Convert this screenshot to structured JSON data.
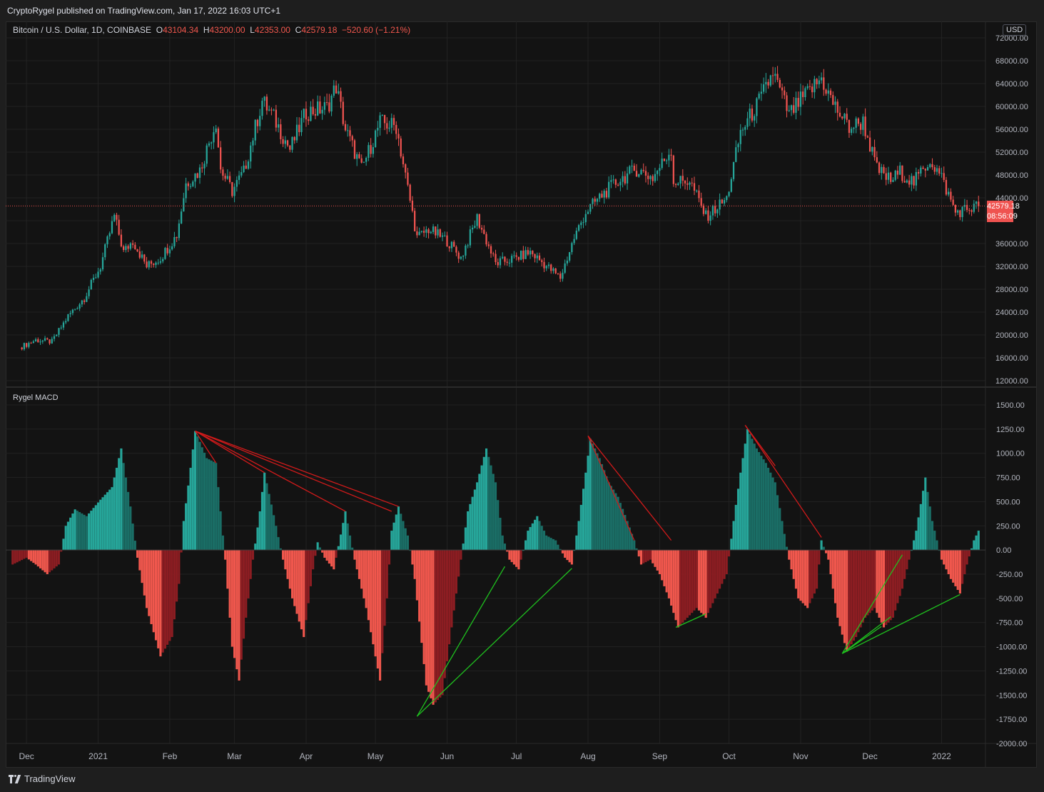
{
  "header": {
    "published": "CryptoRygel published on TradingView.com, Jan 17, 2022 16:03 UTC+1"
  },
  "legend": {
    "symbol": "Bitcoin / U.S. Dollar, 1D, COINBASE",
    "o_label": "O",
    "o": "43104.34",
    "h_label": "H",
    "h": "43200.00",
    "l_label": "L",
    "l": "42353.00",
    "c_label": "C",
    "c": "42579.18",
    "change": "−520.60 (−1.21%)"
  },
  "currency": "USD",
  "last_price": {
    "price": "42579.18",
    "countdown": "08:56:09"
  },
  "indicator_name": "Rygel MACD",
  "footer": {
    "brand": "TradingView"
  },
  "colors": {
    "up": "#26a69a",
    "down": "#ef5350",
    "bear_divergence": "#d21a1a",
    "bull_divergence": "#1fc21f",
    "price_line": "#ef5350"
  },
  "chart_data": [
    {
      "type": "candlestick",
      "title": "Bitcoin / U.S. Dollar, 1D, COINBASE",
      "ylim": [
        12000,
        72000
      ],
      "y_ticks": [
        "72000.00",
        "68000.00",
        "64000.00",
        "60000.00",
        "56000.00",
        "52000.00",
        "48000.00",
        "44000.00",
        "40000.00",
        "36000.00",
        "32000.00",
        "28000.00",
        "24000.00",
        "20000.00",
        "16000.00",
        "12000.00"
      ],
      "x_ticks": [
        "Dec",
        "2021",
        "Feb",
        "Mar",
        "Apr",
        "May",
        "Jun",
        "Jul",
        "Aug",
        "Sep",
        "Oct",
        "Nov",
        "Dec",
        "2022"
      ],
      "close_path": [
        [
          "2020-11-28",
          17800
        ],
        [
          "2020-12-05",
          19100
        ],
        [
          "2020-12-12",
          18800
        ],
        [
          "2020-12-19",
          23300
        ],
        [
          "2020-12-26",
          26500
        ],
        [
          "2021-01-02",
          32000
        ],
        [
          "2021-01-08",
          40800
        ],
        [
          "2021-01-12",
          34500
        ],
        [
          "2021-01-16",
          36500
        ],
        [
          "2021-01-22",
          32000
        ],
        [
          "2021-01-28",
          33500
        ],
        [
          "2021-02-04",
          37500
        ],
        [
          "2021-02-08",
          46500
        ],
        [
          "2021-02-14",
          48800
        ],
        [
          "2021-02-21",
          57400
        ],
        [
          "2021-02-23",
          49000
        ],
        [
          "2021-02-28",
          45200
        ],
        [
          "2021-03-05",
          48500
        ],
        [
          "2021-03-13",
          61000
        ],
        [
          "2021-03-18",
          58000
        ],
        [
          "2021-03-25",
          52500
        ],
        [
          "2021-04-01",
          59000
        ],
        [
          "2021-04-10",
          59800
        ],
        [
          "2021-04-14",
          63500
        ],
        [
          "2021-04-18",
          56000
        ],
        [
          "2021-04-25",
          49000
        ],
        [
          "2021-05-03",
          57200
        ],
        [
          "2021-05-10",
          56500
        ],
        [
          "2021-05-13",
          50000
        ],
        [
          "2021-05-19",
          37000
        ],
        [
          "2021-05-24",
          38500
        ],
        [
          "2021-06-01",
          36500
        ],
        [
          "2021-06-07",
          33500
        ],
        [
          "2021-06-14",
          40500
        ],
        [
          "2021-06-22",
          32500
        ],
        [
          "2021-07-01",
          33500
        ],
        [
          "2021-07-07",
          34500
        ],
        [
          "2021-07-20",
          30000
        ],
        [
          "2021-07-26",
          37000
        ],
        [
          "2021-07-31",
          41500
        ],
        [
          "2021-08-07",
          44500
        ],
        [
          "2021-08-14",
          47000
        ],
        [
          "2021-08-22",
          49000
        ],
        [
          "2021-08-29",
          47500
        ],
        [
          "2021-09-06",
          52500
        ],
        [
          "2021-09-07",
          46800
        ],
        [
          "2021-09-14",
          47000
        ],
        [
          "2021-09-21",
          40700
        ],
        [
          "2021-09-30",
          43800
        ],
        [
          "2021-10-06",
          55500
        ],
        [
          "2021-10-15",
          61500
        ],
        [
          "2021-10-20",
          66000
        ],
        [
          "2021-10-27",
          58500
        ],
        [
          "2021-11-01",
          61000
        ],
        [
          "2021-11-10",
          64900
        ],
        [
          "2021-11-15",
          60500
        ],
        [
          "2021-11-22",
          56300
        ],
        [
          "2021-11-28",
          57300
        ],
        [
          "2021-12-04",
          49000
        ],
        [
          "2021-12-10",
          47000
        ],
        [
          "2021-12-14",
          48500
        ],
        [
          "2021-12-20",
          46700
        ],
        [
          "2021-12-27",
          50700
        ],
        [
          "2022-01-01",
          47500
        ],
        [
          "2022-01-07",
          41500
        ],
        [
          "2022-01-10",
          41800
        ],
        [
          "2022-01-17",
          42579
        ]
      ],
      "last": 42579.18
    },
    {
      "type": "bar",
      "title": "Rygel MACD",
      "ylim": [
        -2000,
        1500
      ],
      "y_ticks": [
        "1500.00",
        "1250.00",
        "1000.00",
        "750.00",
        "500.00",
        "250.00",
        "0.00",
        "-250.00",
        "-500.00",
        "-750.00",
        "-1000.00",
        "-1250.00",
        "-1500.00",
        "-1750.00",
        "-2000.00"
      ],
      "histogram_path": [
        [
          "2020-11-25",
          -150
        ],
        [
          "2020-12-01",
          -80
        ],
        [
          "2020-12-05",
          -150
        ],
        [
          "2020-12-10",
          -250
        ],
        [
          "2020-12-15",
          -150
        ],
        [
          "2020-12-18",
          250
        ],
        [
          "2020-12-22",
          420
        ],
        [
          "2020-12-27",
          350
        ],
        [
          "2021-01-02",
          520
        ],
        [
          "2021-01-07",
          650
        ],
        [
          "2021-01-11",
          1050
        ],
        [
          "2021-01-15",
          450
        ],
        [
          "2021-01-18",
          -80
        ],
        [
          "2021-01-22",
          -600
        ],
        [
          "2021-01-28",
          -1100
        ],
        [
          "2021-02-02",
          -900
        ],
        [
          "2021-02-05",
          -350
        ],
        [
          "2021-02-07",
          300
        ],
        [
          "2021-02-10",
          850
        ],
        [
          "2021-02-12",
          1230
        ],
        [
          "2021-02-17",
          950
        ],
        [
          "2021-02-21",
          900
        ],
        [
          "2021-02-25",
          -100
        ],
        [
          "2021-02-28",
          -1000
        ],
        [
          "2021-03-03",
          -1350
        ],
        [
          "2021-03-06",
          -700
        ],
        [
          "2021-03-09",
          -100
        ],
        [
          "2021-03-12",
          400
        ],
        [
          "2021-03-14",
          800
        ],
        [
          "2021-03-19",
          250
        ],
        [
          "2021-03-22",
          -100
        ],
        [
          "2021-03-26",
          -500
        ],
        [
          "2021-03-31",
          -900
        ],
        [
          "2021-04-04",
          -200
        ],
        [
          "2021-04-06",
          80
        ],
        [
          "2021-04-09",
          -80
        ],
        [
          "2021-04-13",
          -200
        ],
        [
          "2021-04-18",
          400
        ],
        [
          "2021-04-22",
          -100
        ],
        [
          "2021-04-27",
          -600
        ],
        [
          "2021-05-03",
          -1350
        ],
        [
          "2021-05-06",
          -500
        ],
        [
          "2021-05-08",
          200
        ],
        [
          "2021-05-11",
          450
        ],
        [
          "2021-05-15",
          150
        ],
        [
          "2021-05-18",
          -300
        ],
        [
          "2021-05-23",
          -1400
        ],
        [
          "2021-05-26",
          -1600
        ],
        [
          "2021-05-30",
          -1500
        ],
        [
          "2021-06-03",
          -800
        ],
        [
          "2021-06-07",
          -100
        ],
        [
          "2021-06-10",
          400
        ],
        [
          "2021-06-14",
          700
        ],
        [
          "2021-06-18",
          1050
        ],
        [
          "2021-06-22",
          700
        ],
        [
          "2021-06-25",
          150
        ],
        [
          "2021-06-28",
          -100
        ],
        [
          "2021-07-02",
          -200
        ],
        [
          "2021-07-06",
          200
        ],
        [
          "2021-07-10",
          350
        ],
        [
          "2021-07-14",
          150
        ],
        [
          "2021-07-18",
          100
        ],
        [
          "2021-07-22",
          -80
        ],
        [
          "2021-07-25",
          -150
        ],
        [
          "2021-07-28",
          300
        ],
        [
          "2021-07-31",
          800
        ],
        [
          "2021-08-02",
          1150
        ],
        [
          "2021-08-06",
          950
        ],
        [
          "2021-08-10",
          700
        ],
        [
          "2021-08-14",
          550
        ],
        [
          "2021-08-18",
          300
        ],
        [
          "2021-08-21",
          100
        ],
        [
          "2021-08-24",
          -150
        ],
        [
          "2021-08-28",
          -100
        ],
        [
          "2021-09-01",
          -250
        ],
        [
          "2021-09-05",
          -500
        ],
        [
          "2021-09-09",
          -800
        ],
        [
          "2021-09-13",
          -700
        ],
        [
          "2021-09-17",
          -600
        ],
        [
          "2021-09-21",
          -700
        ],
        [
          "2021-09-25",
          -500
        ],
        [
          "2021-09-30",
          -250
        ],
        [
          "2021-10-03",
          300
        ],
        [
          "2021-10-06",
          800
        ],
        [
          "2021-10-09",
          1250
        ],
        [
          "2021-10-13",
          1050
        ],
        [
          "2021-10-17",
          900
        ],
        [
          "2021-10-21",
          700
        ],
        [
          "2021-10-24",
          300
        ],
        [
          "2021-10-27",
          -100
        ],
        [
          "2021-10-31",
          -500
        ],
        [
          "2021-11-04",
          -600
        ],
        [
          "2021-11-08",
          -400
        ],
        [
          "2021-11-10",
          100
        ],
        [
          "2021-11-13",
          -100
        ],
        [
          "2021-11-17",
          -700
        ],
        [
          "2021-11-21",
          -1050
        ],
        [
          "2021-11-25",
          -900
        ],
        [
          "2021-11-29",
          -700
        ],
        [
          "2021-12-03",
          -600
        ],
        [
          "2021-12-07",
          -800
        ],
        [
          "2021-12-11",
          -700
        ],
        [
          "2021-12-15",
          -400
        ],
        [
          "2021-12-18",
          -100
        ],
        [
          "2021-12-21",
          200
        ],
        [
          "2021-12-25",
          750
        ],
        [
          "2021-12-28",
          300
        ],
        [
          "2022-01-01",
          -100
        ],
        [
          "2022-01-05",
          -300
        ],
        [
          "2022-01-09",
          -450
        ],
        [
          "2022-01-12",
          -150
        ],
        [
          "2022-01-15",
          100
        ],
        [
          "2022-01-17",
          200
        ]
      ],
      "bearish_divergences": [
        [
          [
            "2021-02-12",
            1230
          ],
          [
            "2021-02-21",
            900
          ]
        ],
        [
          [
            "2021-02-12",
            1230
          ],
          [
            "2021-03-14",
            800
          ]
        ],
        [
          [
            "2021-02-12",
            1230
          ],
          [
            "2021-04-18",
            400
          ]
        ],
        [
          [
            "2021-02-12",
            1230
          ],
          [
            "2021-05-08",
            400
          ]
        ],
        [
          [
            "2021-02-12",
            1230
          ],
          [
            "2021-05-11",
            450
          ]
        ],
        [
          [
            "2021-08-01",
            1180
          ],
          [
            "2021-08-21",
            100
          ]
        ],
        [
          [
            "2021-08-01",
            1180
          ],
          [
            "2021-09-06",
            100
          ]
        ],
        [
          [
            "2021-10-08",
            1290
          ],
          [
            "2021-10-21",
            870
          ]
        ],
        [
          [
            "2021-10-08",
            1290
          ],
          [
            "2021-11-10",
            130
          ]
        ]
      ],
      "bullish_divergences": [
        [
          [
            "2021-05-19",
            -1720
          ],
          [
            "2021-06-26",
            -170
          ]
        ],
        [
          [
            "2021-05-19",
            -1720
          ],
          [
            "2021-07-25",
            -190
          ]
        ],
        [
          [
            "2021-09-08",
            -800
          ],
          [
            "2021-09-21",
            -660
          ]
        ],
        [
          [
            "2021-11-19",
            -1070
          ],
          [
            "2021-12-06",
            -790
          ]
        ],
        [
          [
            "2021-11-19",
            -1070
          ],
          [
            "2021-12-10",
            -690
          ]
        ],
        [
          [
            "2021-11-19",
            -1070
          ],
          [
            "2021-12-15",
            -50
          ]
        ],
        [
          [
            "2021-11-19",
            -1070
          ],
          [
            "2022-01-09",
            -460
          ]
        ]
      ]
    }
  ]
}
